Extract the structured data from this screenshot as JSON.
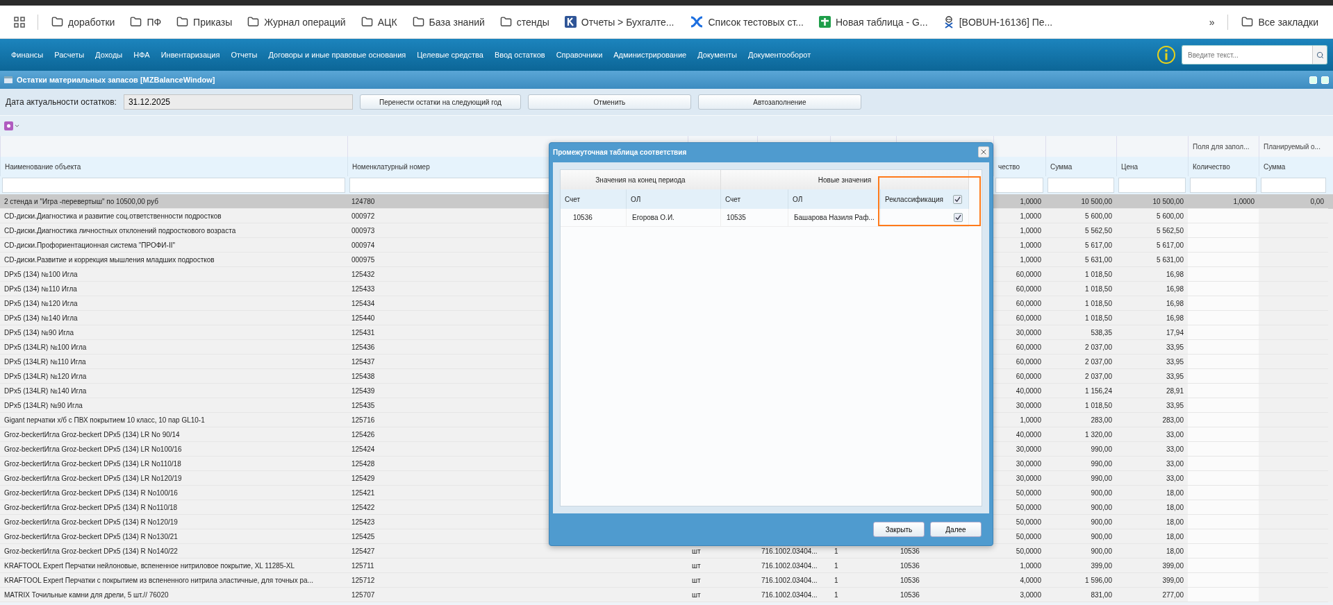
{
  "bookmarks": [
    {
      "kind": "apps"
    },
    {
      "kind": "folder",
      "label": "доработки"
    },
    {
      "kind": "folder",
      "label": "ПФ"
    },
    {
      "kind": "folder",
      "label": "Приказы"
    },
    {
      "kind": "folder",
      "label": "Журнал операций"
    },
    {
      "kind": "folder",
      "label": "АЦК"
    },
    {
      "kind": "folder",
      "label": "База знаний"
    },
    {
      "kind": "folder",
      "label": "стенды"
    },
    {
      "kind": "k-logo",
      "label": "Отчеты > Бухгалте..."
    },
    {
      "kind": "x-logo",
      "label": "Список тестовых ст..."
    },
    {
      "kind": "sheet",
      "label": "Новая таблица - G..."
    },
    {
      "kind": "mascot",
      "label": "[BOBUH-16136] Пе..."
    }
  ],
  "bookmarks_overflow": "»",
  "all_bookmarks": "Все закладки",
  "menu": [
    "Финансы",
    "Расчеты",
    "Доходы",
    "НФА",
    "Инвентаризация",
    "Отчеты",
    "Договоры и иные правовые основания",
    "Целевые средства",
    "Ввод остатков",
    "Справочники",
    "Администрирование",
    "Документы",
    "Документооборот"
  ],
  "search": {
    "placeholder": "Введите текст..."
  },
  "window": {
    "title": "Остатки материальных запасов [MZBalanceWindow]"
  },
  "form": {
    "date_label": "Дата актуальности остатков:",
    "date_value": "31.12.2025",
    "buttons": [
      "Перенести остатки на следующий год",
      "Отменить",
      "Автозаполнение"
    ]
  },
  "table": {
    "group_headers": [
      "Поля для запол...",
      "Планируемый о..."
    ],
    "columns": [
      "Наименование объекта",
      "Номенклатурный номер",
      "чество",
      "Сумма",
      "Цена",
      "Количество",
      "Сумма"
    ],
    "rows": [
      {
        "selected": true,
        "name": "2 стенда и \"Игра -перевертыш\" по 10500,00 руб",
        "nomenclature": "124780",
        "quantity": "1,0000",
        "sum": "10 500,00",
        "price": "10 500,00",
        "plan_quantity": "1,0000",
        "plan_sum": "0,00"
      },
      {
        "selected": false,
        "name": "CD-диски.Диагностика и развитие соц.ответственности подростков",
        "nomenclature": "000972",
        "quantity": "1,0000",
        "sum": "5 600,00",
        "price": "5 600,00"
      },
      {
        "selected": false,
        "name": "CD-диски.Диагностика личностных отклонений подросткового возраста",
        "nomenclature": "000973",
        "quantity": "1,0000",
        "sum": "5 562,50",
        "price": "5 562,50"
      },
      {
        "selected": false,
        "name": "CD-диски.Профориентационная система \"ПРОФИ-II\"",
        "nomenclature": "000974",
        "quantity": "1,0000",
        "sum": "5 617,00",
        "price": "5 617,00"
      },
      {
        "selected": false,
        "name": "CD-диски.Развитие и коррекция мышления младших подростков",
        "nomenclature": "000975",
        "quantity": "1,0000",
        "sum": "5 631,00",
        "price": "5 631,00"
      },
      {
        "selected": false,
        "name": "DPx5 (134) №100 Игла",
        "nomenclature": "125432",
        "quantity": "60,0000",
        "sum": "1 018,50",
        "price": "16,98"
      },
      {
        "selected": false,
        "name": "DPx5 (134) №110 Игла",
        "nomenclature": "125433",
        "quantity": "60,0000",
        "sum": "1 018,50",
        "price": "16,98"
      },
      {
        "selected": false,
        "name": "DPx5 (134) №120 Игла",
        "nomenclature": "125434",
        "quantity": "60,0000",
        "sum": "1 018,50",
        "price": "16,98"
      },
      {
        "selected": false,
        "name": "DPx5 (134) №140 Игла",
        "nomenclature": "125440",
        "quantity": "60,0000",
        "sum": "1 018,50",
        "price": "16,98"
      },
      {
        "selected": false,
        "name": "DPx5 (134) №90 Игла",
        "nomenclature": "125431",
        "quantity": "30,0000",
        "sum": "538,35",
        "price": "17,94"
      },
      {
        "selected": false,
        "name": "DPx5 (134LR) №100 Игла",
        "nomenclature": "125436",
        "quantity": "60,0000",
        "sum": "2 037,00",
        "price": "33,95"
      },
      {
        "selected": false,
        "name": "DPx5 (134LR) №110 Игла",
        "nomenclature": "125437",
        "quantity": "60,0000",
        "sum": "2 037,00",
        "price": "33,95"
      },
      {
        "selected": false,
        "name": "DPx5 (134LR) №120 Игла",
        "nomenclature": "125438",
        "quantity": "60,0000",
        "sum": "2 037,00",
        "price": "33,95"
      },
      {
        "selected": false,
        "name": "DPx5 (134LR) №140 Игла",
        "nomenclature": "125439",
        "quantity": "40,0000",
        "sum": "1 156,24",
        "price": "28,91"
      },
      {
        "selected": false,
        "name": "DPx5 (134LR) №90 Игла",
        "nomenclature": "125435",
        "quantity": "30,0000",
        "sum": "1 018,50",
        "price": "33,95"
      },
      {
        "selected": false,
        "name": "Gigant перчатки х/б с ПВХ покрытием 10 класс, 10 пар GL10-1",
        "nomenclature": "125716",
        "quantity": "1,0000",
        "sum": "283,00",
        "price": "283,00"
      },
      {
        "selected": false,
        "name": "Groz-beckertИгла Groz-beckert DPx5 (134) LR No 90/14",
        "nomenclature": "125426",
        "quantity": "40,0000",
        "sum": "1 320,00",
        "price": "33,00"
      },
      {
        "selected": false,
        "name": "Groz-beckertИгла Groz-beckert DPx5 (134) LR No100/16",
        "nomenclature": "125424",
        "quantity": "30,0000",
        "sum": "990,00",
        "price": "33,00"
      },
      {
        "selected": false,
        "name": "Groz-beckertИгла Groz-beckert DPx5 (134) LR No110/18",
        "nomenclature": "125428",
        "quantity": "30,0000",
        "sum": "990,00",
        "price": "33,00"
      },
      {
        "selected": false,
        "name": "Groz-beckertИгла Groz-beckert DPx5 (134) LR No120/19",
        "nomenclature": "125429",
        "quantity": "30,0000",
        "sum": "990,00",
        "price": "33,00"
      },
      {
        "selected": false,
        "name": "Groz-beckertИгла Groz-beckert DPx5 (134) R No100/16",
        "nomenclature": "125421",
        "quantity": "50,0000",
        "sum": "900,00",
        "price": "18,00"
      },
      {
        "selected": false,
        "name": "Groz-beckertИгла Groz-beckert DPx5 (134) R No110/18",
        "nomenclature": "125422",
        "quantity": "50,0000",
        "sum": "900,00",
        "price": "18,00"
      },
      {
        "selected": false,
        "name": "Groz-beckertИгла Groz-beckert DPx5 (134) R No120/19",
        "nomenclature": "125423",
        "quantity": "50,0000",
        "sum": "900,00",
        "price": "18,00"
      },
      {
        "selected": false,
        "name": "Groz-beckertИгла Groz-beckert DPx5 (134) R No130/21",
        "nomenclature": "125425",
        "quantity": "50,0000",
        "sum": "900,00",
        "price": "18,00"
      },
      {
        "selected": false,
        "name": "Groz-beckertИгла Groz-beckert DPx5 (134) R No140/22",
        "nomenclature": "125427",
        "column_3": "шт",
        "column_4": "716.1002.03404...",
        "column_5": "1",
        "column_6": "10536",
        "quantity": "50,0000",
        "sum": "900,00",
        "price": "18,00"
      },
      {
        "selected": false,
        "name": "KRAFTOOL Expert Перчатки нейлоновые, вспененное нитриловое покрытие, XL 11285-XL",
        "nomenclature": "125711",
        "column_3": "шт",
        "column_4": "716.1002.03404...",
        "column_5": "1",
        "column_6": "10536",
        "quantity": "1,0000",
        "sum": "399,00",
        "price": "399,00"
      },
      {
        "selected": false,
        "name": "KRAFTOOL Expert Перчатки с покрытием из вспененного нитрила эластичные, для точных ра...",
        "nomenclature": "125712",
        "column_3": "шт",
        "column_4": "716.1002.03404...",
        "column_5": "1",
        "column_6": "10536",
        "quantity": "4,0000",
        "sum": "1 596,00",
        "price": "399,00"
      },
      {
        "selected": false,
        "name": "MATRIX Точильные камни для дрели, 5 шт.// 76020",
        "nomenclature": "125707",
        "column_3": "шт",
        "column_4": "716.1002.03404...",
        "column_5": "1",
        "column_6": "10536",
        "quantity": "3,0000",
        "sum": "831,00",
        "price": "277,00"
      }
    ]
  },
  "dialog": {
    "title": "Промежуточная таблица соответствия",
    "groups": [
      "Значения на конец периода",
      "Новые значения"
    ],
    "columns": [
      "Счет",
      "ОЛ",
      "Счет",
      "ОЛ",
      "Реклассификация"
    ],
    "reclass_header_checked": true,
    "rows": [
      {
        "cells": [
          "10536",
          "Егорова О.И.",
          "10535",
          "Башарова Назиля Раф..."
        ],
        "reclassification": true
      }
    ],
    "buttons": [
      "Закрыть",
      "Далее"
    ]
  }
}
